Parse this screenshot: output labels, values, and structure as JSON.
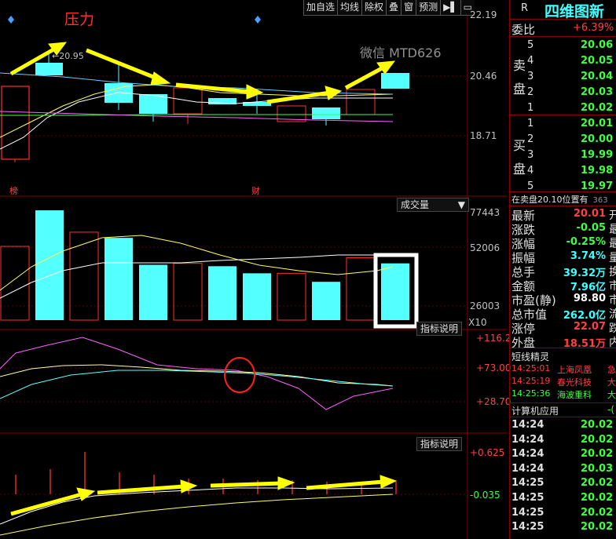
{
  "toolbar": {
    "items": [
      "加自选",
      "均线",
      "除权",
      "叠",
      "窗",
      "预测"
    ],
    "menu_icon": "menu-arrow-icon",
    "sub_icon": "window-sub-icon"
  },
  "price_panel": {
    "axis_top": "22.19",
    "axis_mid": "20.46",
    "axis_low": "18.71",
    "high_label": "20.95",
    "pressure_text": "压力",
    "watermark": "微信 MTD626",
    "marker_left": "榜",
    "marker_mid": "财"
  },
  "volume_panel": {
    "dropdown": "成交量",
    "axis": [
      "77443",
      "52006",
      "26003"
    ],
    "unit": "X10",
    "values": [
      52000,
      77400,
      62000,
      58000,
      39000,
      40000,
      38000,
      33000,
      33000,
      27000,
      44000,
      40000
    ]
  },
  "macd_panel": {
    "label": "指标说明",
    "axis": [
      "+116.2",
      "+73.00",
      "+28.70"
    ]
  },
  "ind2_panel": {
    "label": "指标说明",
    "axis": [
      "+0.625",
      "-0.035"
    ]
  },
  "quote": {
    "title_r": "R",
    "name": "四维图新",
    "wei_bi_label": "委比",
    "wei_bi": "+6.39%",
    "sell_label_1": "卖",
    "sell_label_2": "盘",
    "buy_label_1": "买",
    "buy_label_2": "盘",
    "sells": [
      {
        "lvl": "5",
        "price": "20.06"
      },
      {
        "lvl": "4",
        "price": "20.05"
      },
      {
        "lvl": "3",
        "price": "20.04"
      },
      {
        "lvl": "2",
        "price": "20.03"
      },
      {
        "lvl": "1",
        "price": "20.02"
      }
    ],
    "buys": [
      {
        "lvl": "1",
        "price": "20.01"
      },
      {
        "lvl": "2",
        "price": "20.00"
      },
      {
        "lvl": "3",
        "price": "19.99"
      },
      {
        "lvl": "4",
        "price": "19.98"
      },
      {
        "lvl": "5",
        "price": "19.97"
      }
    ],
    "notice": "在卖盘20.10位置有",
    "notice_num": "363",
    "stats": [
      {
        "k": "最新",
        "v": "20.01",
        "s": "开",
        "c": "#ff4040"
      },
      {
        "k": "涨跌",
        "v": "-0.05",
        "s": "最",
        "c": "#40ff40"
      },
      {
        "k": "涨幅",
        "v": "-0.25%",
        "s": "最",
        "c": "#40ff40"
      },
      {
        "k": "振幅",
        "v": "3.74%",
        "s": "量",
        "c": "#40ffff"
      },
      {
        "k": "总手",
        "v": "39.32万",
        "s": "换",
        "c": "#40ffff"
      },
      {
        "k": "金额",
        "v": "7.96亿",
        "s": "市",
        "c": "#40ffff"
      },
      {
        "k": "市盈(静)",
        "v": "98.80",
        "s": "市",
        "c": "#ffffff"
      },
      {
        "k": "总市值",
        "v": "262.0亿",
        "s": "流",
        "c": "#40ffff"
      },
      {
        "k": "涨停",
        "v": "22.07",
        "s": "跌",
        "c": "#ff4040"
      },
      {
        "k": "外盘",
        "v": "18.51万",
        "s": "内",
        "c": "#ff4040"
      }
    ],
    "elf_title": "短线精灵",
    "elf": [
      {
        "t": "14:25:01",
        "n": "上海凤凰",
        "x": "急",
        "c": "#ff4040"
      },
      {
        "t": "14:25:19",
        "n": "春光科技",
        "x": "大",
        "c": "#ff4040"
      },
      {
        "t": "14:25:36",
        "n": "海波重科",
        "x": "大",
        "c": "#40ff40"
      }
    ],
    "sector": "计算机应用",
    "sector_val": "-(",
    "ticks": [
      {
        "t": "14:24",
        "p": "20.02",
        "c": "#40ff40"
      },
      {
        "t": "14:24",
        "p": "20.02",
        "c": "#40ff40"
      },
      {
        "t": "14:24",
        "p": "20.02",
        "c": "#40ff40"
      },
      {
        "t": "14:24",
        "p": "20.03",
        "c": "#40ff40"
      },
      {
        "t": "14:25",
        "p": "20.02",
        "c": "#40ff40"
      },
      {
        "t": "14:25",
        "p": "20.02",
        "c": "#40ff40"
      },
      {
        "t": "14:25",
        "p": "20.02",
        "c": "#40ff40"
      },
      {
        "t": "14:25",
        "p": "20.02",
        "c": "#40ff40"
      }
    ]
  }
}
